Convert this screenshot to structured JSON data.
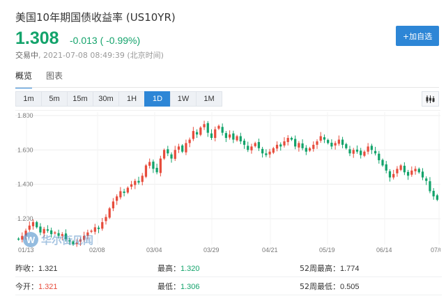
{
  "header": {
    "title": "美国10年期国债收益率 (US10YR)",
    "price": "1.308",
    "change": "-0.013 ( -0.99%)",
    "status_label": "交易中",
    "timestamp": ", 2021-07-08 08:49:39 (北京时间)",
    "add_button": "+加自选"
  },
  "tabs": [
    {
      "label": "概览",
      "active": true
    },
    {
      "label": "图表",
      "active": false
    }
  ],
  "periods": [
    {
      "label": "1m",
      "active": false
    },
    {
      "label": "5m",
      "active": false
    },
    {
      "label": "15m",
      "active": false
    },
    {
      "label": "30m",
      "active": false
    },
    {
      "label": "1H",
      "active": false
    },
    {
      "label": "1D",
      "active": true
    },
    {
      "label": "1W",
      "active": false
    },
    {
      "label": "1M",
      "active": false
    }
  ],
  "watermark": {
    "logo": "W",
    "text": "华尔街见闻"
  },
  "colors": {
    "up": "#e74c3c",
    "down": "#13a36b",
    "accent": "#2d86d6"
  },
  "chart_data": {
    "type": "candlestick",
    "x_ticks": [
      "01/13",
      "02/08",
      "03/04",
      "03/29",
      "04/21",
      "05/19",
      "06/14",
      "07/0"
    ],
    "y_ticks": [
      "1.800",
      "1.600",
      "1.400",
      "1.200"
    ],
    "ylim": [
      1.05,
      1.82
    ],
    "grid": true,
    "closes": [
      1.08,
      1.1,
      1.13,
      1.16,
      1.18,
      1.15,
      1.12,
      1.14,
      1.13,
      1.11,
      1.12,
      1.1,
      1.11,
      1.08,
      1.07,
      1.05,
      1.06,
      1.08,
      1.1,
      1.12,
      1.13,
      1.15,
      1.14,
      1.18,
      1.21,
      1.26,
      1.3,
      1.33,
      1.36,
      1.35,
      1.38,
      1.4,
      1.42,
      1.41,
      1.45,
      1.51,
      1.53,
      1.49,
      1.47,
      1.55,
      1.6,
      1.58,
      1.55,
      1.6,
      1.62,
      1.59,
      1.64,
      1.66,
      1.71,
      1.69,
      1.73,
      1.75,
      1.7,
      1.67,
      1.72,
      1.74,
      1.7,
      1.67,
      1.69,
      1.66,
      1.68,
      1.65,
      1.63,
      1.6,
      1.62,
      1.64,
      1.61,
      1.58,
      1.57,
      1.59,
      1.61,
      1.63,
      1.62,
      1.65,
      1.67,
      1.66,
      1.62,
      1.64,
      1.61,
      1.59,
      1.61,
      1.63,
      1.65,
      1.68,
      1.66,
      1.64,
      1.62,
      1.64,
      1.66,
      1.63,
      1.61,
      1.58,
      1.6,
      1.59,
      1.57,
      1.59,
      1.62,
      1.6,
      1.58,
      1.54,
      1.51,
      1.48,
      1.44,
      1.46,
      1.49,
      1.51,
      1.47,
      1.45,
      1.48,
      1.49,
      1.47,
      1.44,
      1.42,
      1.36,
      1.33,
      1.31
    ],
    "series_name": "US10YR"
  },
  "stats": [
    [
      {
        "label": "昨收：",
        "value": "1.321",
        "tone": "neutral"
      },
      {
        "label": "最高：",
        "value": "1.320",
        "tone": "green"
      },
      {
        "label": "52周最高：",
        "value": "1.774",
        "tone": "neutral"
      }
    ],
    [
      {
        "label": "今开：",
        "value": "1.321",
        "tone": "red"
      },
      {
        "label": "最低：",
        "value": "1.306",
        "tone": "green"
      },
      {
        "label": "52周最低：",
        "value": "0.505",
        "tone": "neutral"
      }
    ]
  ]
}
